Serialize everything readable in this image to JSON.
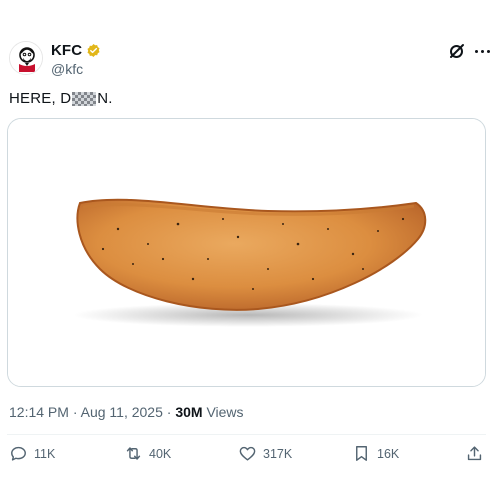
{
  "tweet": {
    "display_name": "KFC",
    "handle": "@kfc",
    "text_before": "HERE, D",
    "text_after": "N.",
    "time": "12:14 PM",
    "date": "Aug 11, 2025",
    "views_count": "30M",
    "views_label": "Views",
    "media_description": "potato wedge"
  },
  "actions": {
    "replies": "11K",
    "reposts": "40K",
    "likes": "317K",
    "bookmarks": "16K"
  },
  "icons": {
    "verified": "verified-badge-icon",
    "grok": "grok-icon",
    "more": "more-icon",
    "reply": "reply-icon",
    "repost": "repost-icon",
    "like": "like-icon",
    "bookmark": "bookmark-icon",
    "share": "share-icon"
  },
  "colors": {
    "text": "#0f1419",
    "secondary": "#536471",
    "verified_gold": "#e2b719",
    "border": "#cfd9de"
  }
}
